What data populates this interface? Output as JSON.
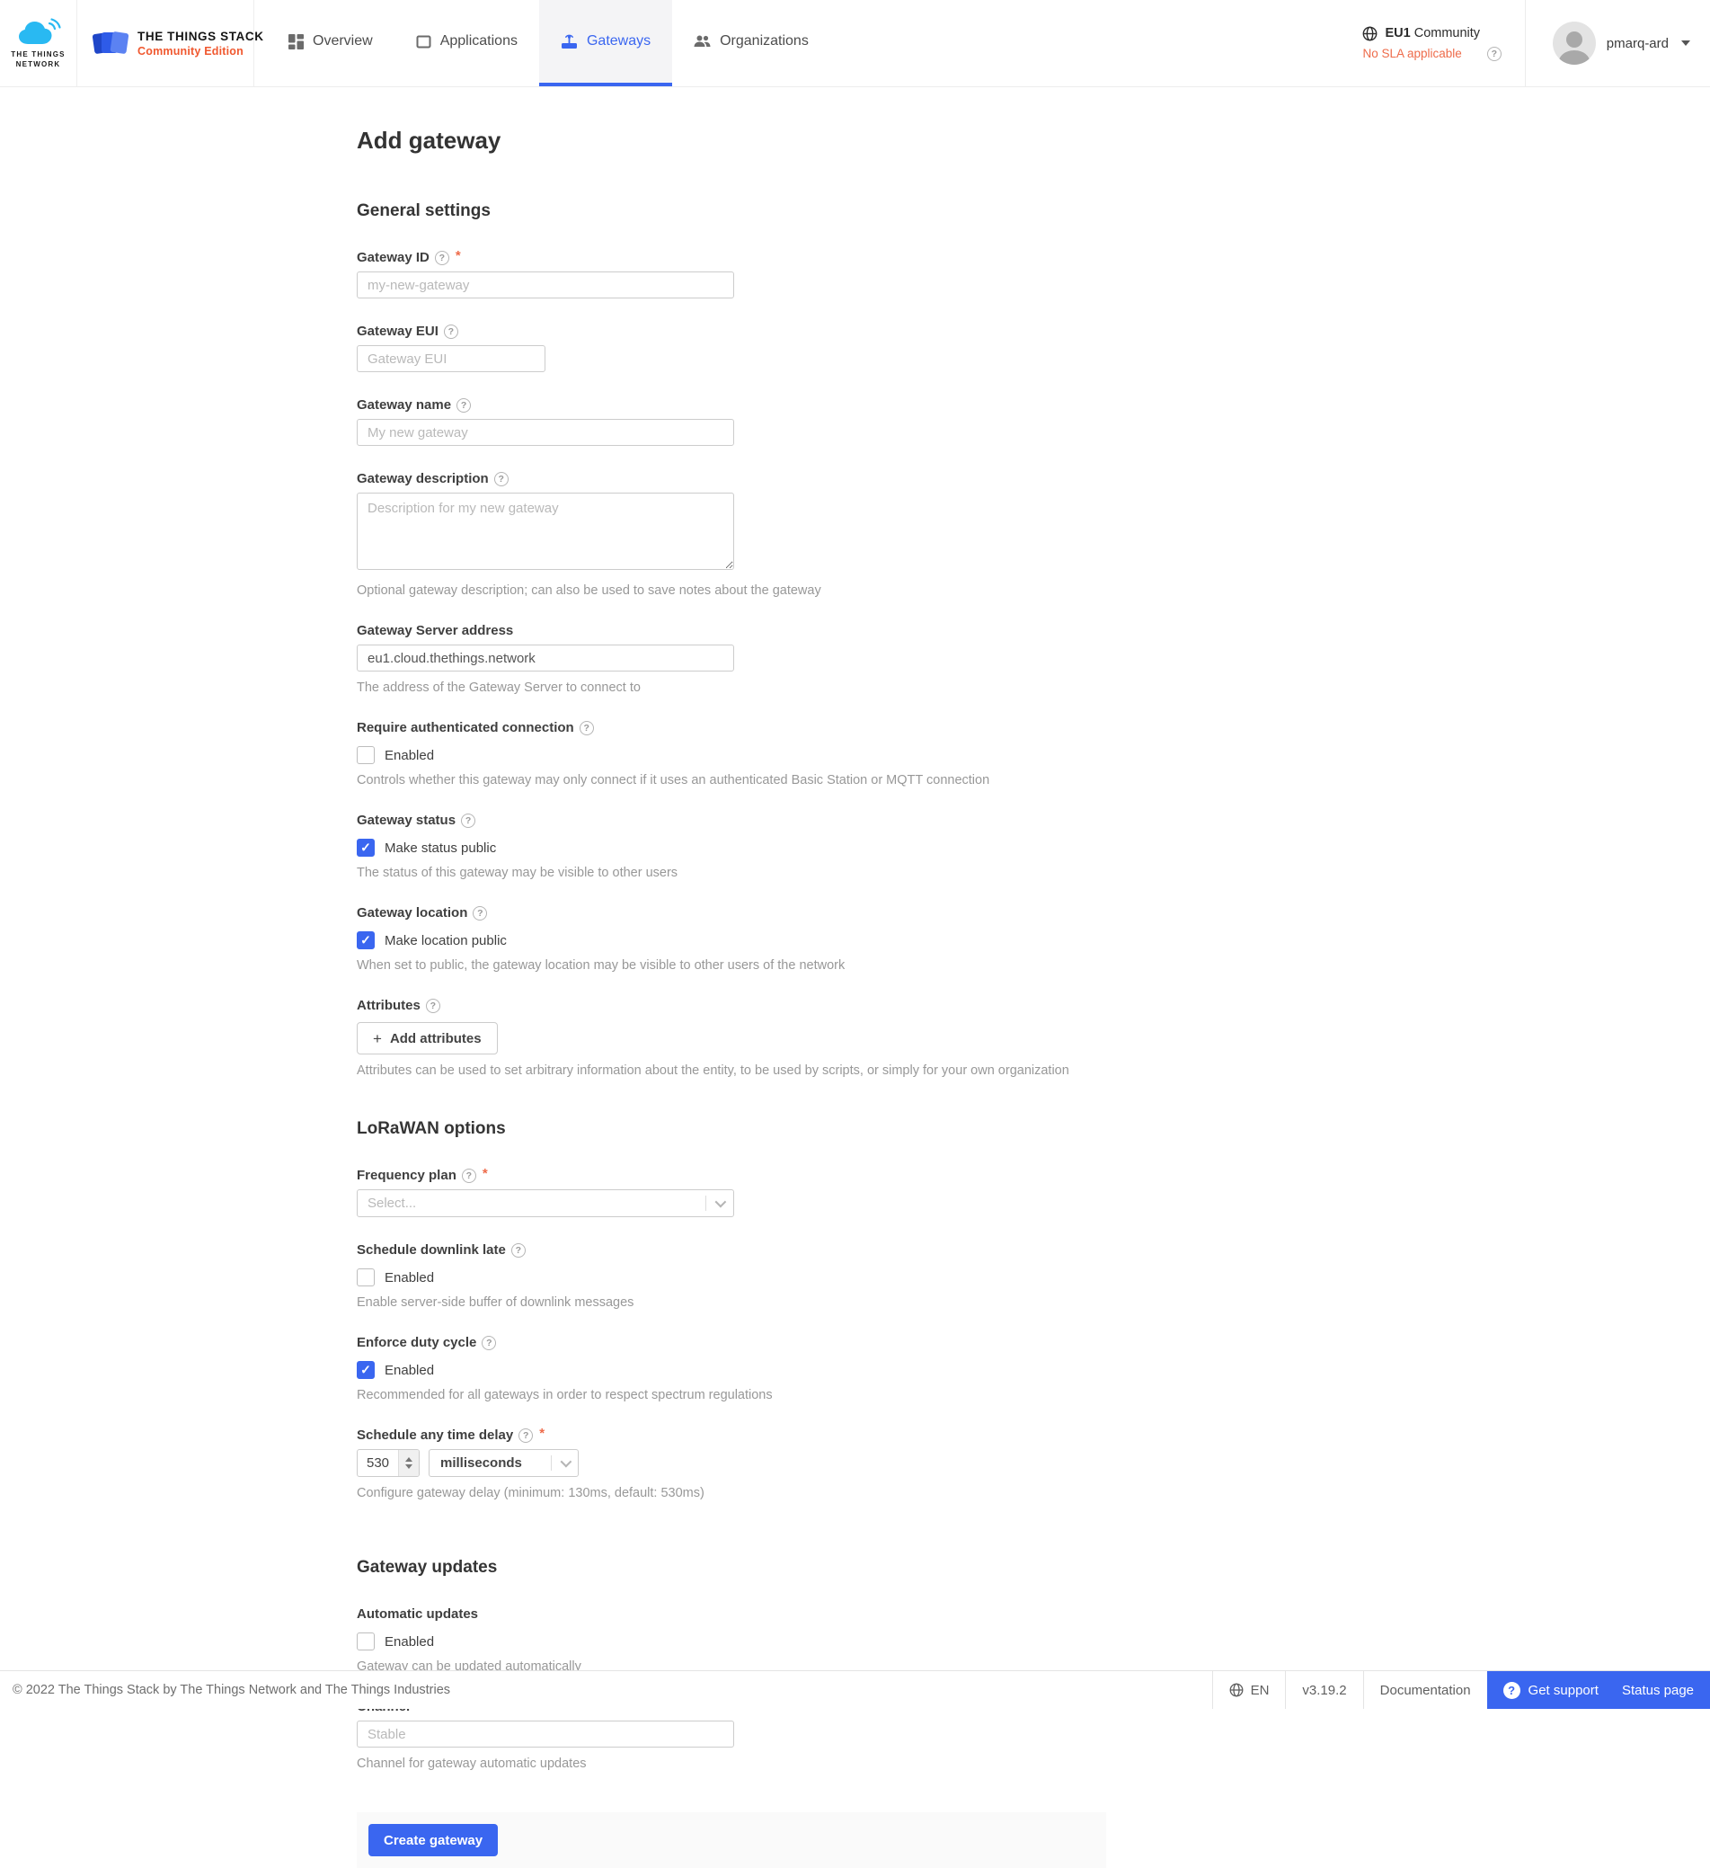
{
  "ui": {
    "required_marker": "*",
    "check": "✓",
    "plus": "+",
    "question": "?"
  },
  "colors": {
    "accent_blue": "#3a66f0",
    "accent_orange": "#ee6b4a",
    "brand_subtitle_orange": "#f0582f",
    "brand_cloud_blue": "#29b9f2"
  },
  "header": {
    "brand_network": {
      "line1": "THE THINGS",
      "line2": "NETWORK"
    },
    "brand_stack": {
      "title": "THE THINGS STACK",
      "subtitle": "Community Edition"
    },
    "nav": [
      {
        "label": "Overview"
      },
      {
        "label": "Applications"
      },
      {
        "label": "Gateways"
      },
      {
        "label": "Organizations"
      }
    ],
    "cluster": {
      "name": "EU1",
      "scope": "Community",
      "sla": "No SLA applicable"
    },
    "user": {
      "name": "pmarq-ard"
    }
  },
  "page": {
    "title": "Add gateway"
  },
  "general": {
    "heading": "General settings",
    "gateway_id": {
      "label": "Gateway ID",
      "placeholder": "my-new-gateway"
    },
    "gateway_eui": {
      "label": "Gateway EUI",
      "placeholder": "Gateway EUI"
    },
    "gateway_name": {
      "label": "Gateway name",
      "placeholder": "My new gateway"
    },
    "gateway_description": {
      "label": "Gateway description",
      "placeholder": "Description for my new gateway",
      "helper": "Optional gateway description; can also be used to save notes about the gateway"
    },
    "gateway_server_address": {
      "label": "Gateway Server address",
      "value": "eu1.cloud.thethings.network",
      "helper": "The address of the Gateway Server to connect to"
    },
    "require_authenticated_connection": {
      "label": "Require authenticated connection",
      "checkbox_label": "Enabled",
      "checked": false,
      "helper": "Controls whether this gateway may only connect if it uses an authenticated Basic Station or MQTT connection"
    },
    "gateway_status": {
      "label": "Gateway status",
      "checkbox_label": "Make status public",
      "checked": true,
      "helper": "The status of this gateway may be visible to other users"
    },
    "gateway_location": {
      "label": "Gateway location",
      "checkbox_label": "Make location public",
      "checked": true,
      "helper": "When set to public, the gateway location may be visible to other users of the network"
    },
    "attributes": {
      "label": "Attributes",
      "button_label": "Add attributes",
      "helper": "Attributes can be used to set arbitrary information about the entity, to be used by scripts, or simply for your own organization"
    }
  },
  "lorawan": {
    "heading": "LoRaWAN options",
    "frequency_plan": {
      "label": "Frequency plan",
      "placeholder": "Select..."
    },
    "schedule_downlink_late": {
      "label": "Schedule downlink late",
      "checkbox_label": "Enabled",
      "checked": false,
      "helper": "Enable server-side buffer of downlink messages"
    },
    "enforce_duty_cycle": {
      "label": "Enforce duty cycle",
      "checkbox_label": "Enabled",
      "checked": true,
      "helper": "Recommended for all gateways in order to respect spectrum regulations"
    },
    "schedule_any_time_delay": {
      "label": "Schedule any time delay",
      "value": "530",
      "unit": "milliseconds",
      "helper": "Configure gateway delay (minimum: 130ms, default: 530ms)"
    }
  },
  "updates": {
    "heading": "Gateway updates",
    "automatic_updates": {
      "label": "Automatic updates",
      "checkbox_label": "Enabled",
      "checked": false,
      "helper": "Gateway can be updated automatically"
    },
    "channel": {
      "label": "Channel",
      "placeholder": "Stable",
      "helper": "Channel for gateway automatic updates"
    }
  },
  "submit": {
    "label": "Create gateway"
  },
  "footer": {
    "copyright": "© 2022 The Things Stack by The Things Network and The Things Industries",
    "language": "EN",
    "version": "v3.19.2",
    "documentation": "Documentation",
    "get_support": "Get support",
    "status_page": "Status page"
  }
}
